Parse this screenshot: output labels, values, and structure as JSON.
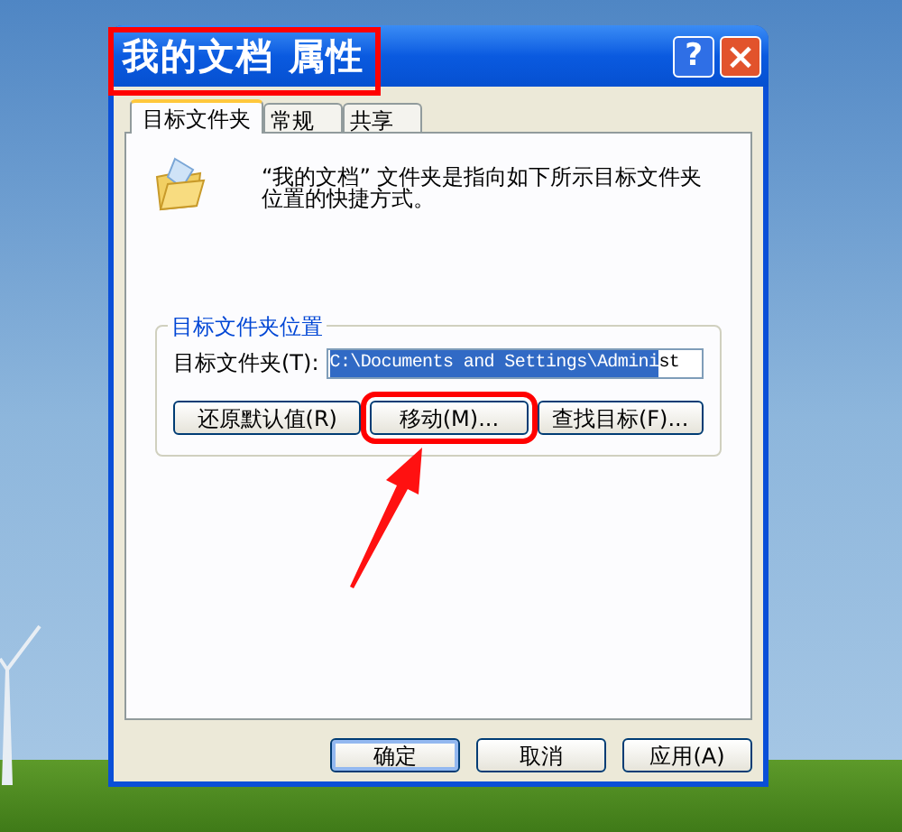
{
  "window": {
    "title": "我的文档 属性",
    "title_highlighted": true,
    "help_button": "?",
    "close_button": "×"
  },
  "tabs": [
    {
      "label": "目标文件夹",
      "selected": true
    },
    {
      "label": "常规",
      "selected": false
    },
    {
      "label": "共享",
      "selected": false
    }
  ],
  "description": "“我的文档” 文件夹是指向如下所示目标文件夹位置的快捷方式。",
  "group": {
    "legend": "目标文件夹位置",
    "field_label": "目标文件夹(T):",
    "field_value_selected": "C:\\Documents and Settings\\Admini",
    "field_value_rest": "st",
    "buttons": [
      {
        "label": "还原默认值(R)",
        "highlighted": false
      },
      {
        "label": "移动(M)...",
        "highlighted": true
      },
      {
        "label": "查找目标(F)...",
        "highlighted": false
      }
    ]
  },
  "footer_buttons": [
    {
      "label": "确定",
      "default": true
    },
    {
      "label": "取消",
      "default": false
    },
    {
      "label": "应用(A)",
      "default": false
    }
  ]
}
